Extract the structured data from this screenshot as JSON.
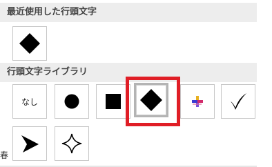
{
  "recent_section": {
    "title": "最近使用した行頭文字",
    "items": [
      {
        "icon": "black-diamond-bullet"
      }
    ]
  },
  "library_section": {
    "title": "行頭文字ライブラリ",
    "items": [
      {
        "label": "なし"
      },
      {
        "icon": "black-circle-bullet"
      },
      {
        "icon": "black-square-bullet"
      },
      {
        "icon": "black-diamond-bullet",
        "selected": true
      },
      {
        "icon": "color-cross-bullet"
      },
      {
        "icon": "check-mark-bullet"
      },
      {
        "icon": "arrowhead-bullet"
      },
      {
        "icon": "four-point-star-bullet"
      }
    ]
  },
  "highlight_color": "#e01e26",
  "background_fragment": "春"
}
